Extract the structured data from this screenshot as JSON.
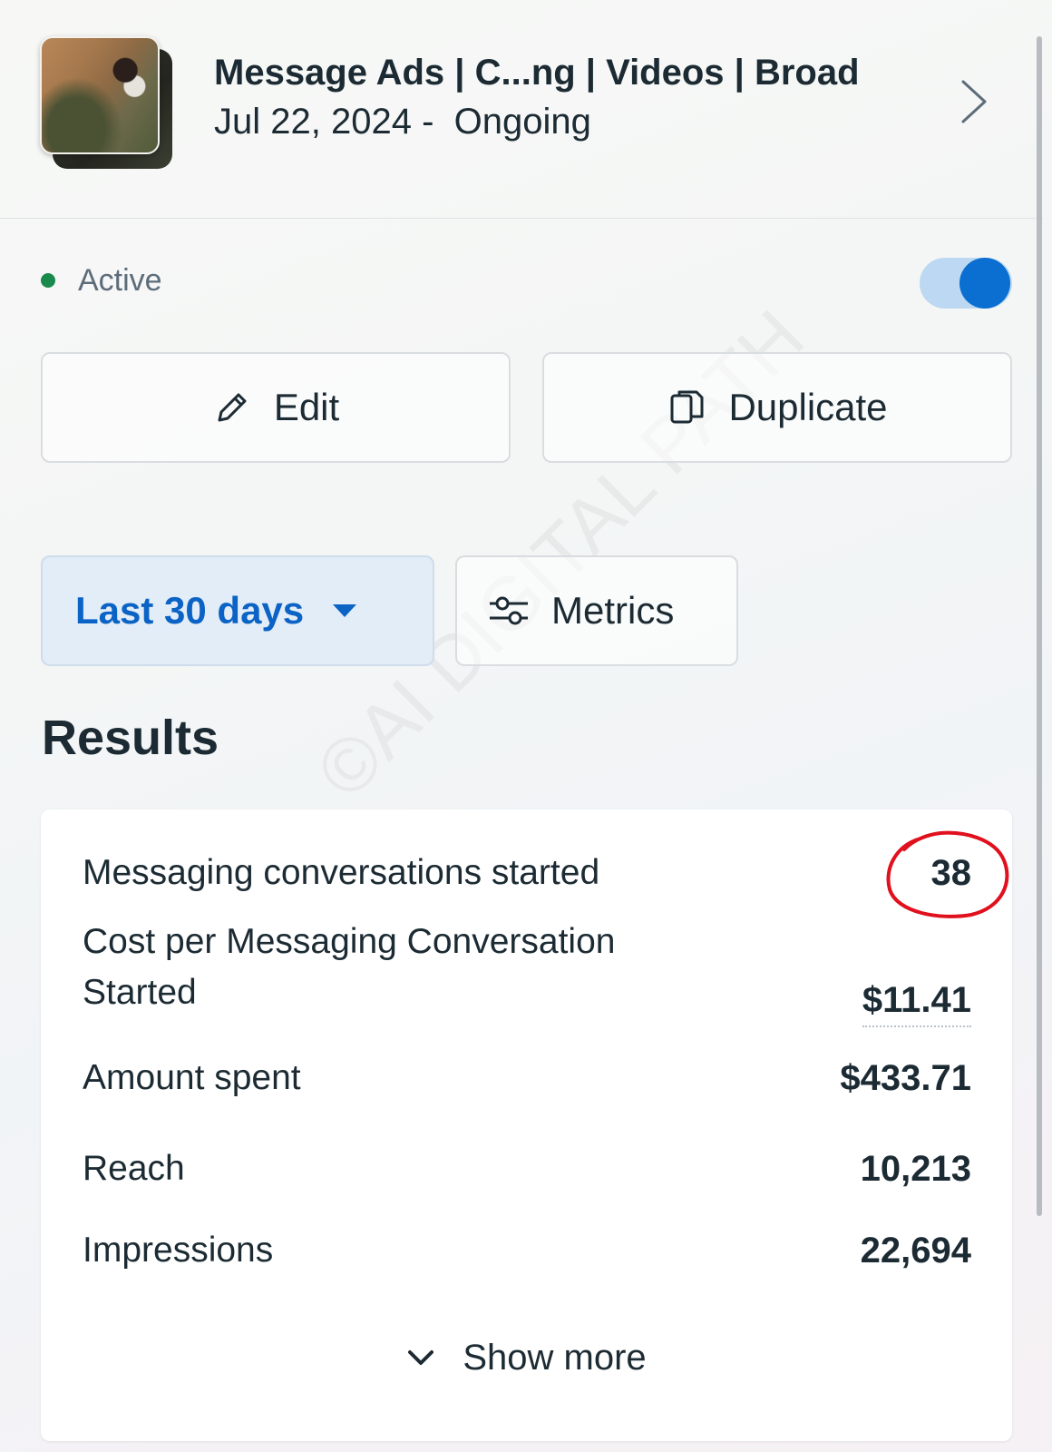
{
  "campaign": {
    "title": "Message Ads | C...ng | Videos | Broad",
    "date_range": "Jul 22, 2024 -  Ongoing"
  },
  "status": {
    "label": "Active",
    "toggle_on": true,
    "dot_color": "#1a8a4c"
  },
  "actions": {
    "edit_label": "Edit",
    "duplicate_label": "Duplicate"
  },
  "filters": {
    "date_range_label": "Last 30 days",
    "metrics_label": "Metrics"
  },
  "results": {
    "title": "Results",
    "rows": [
      {
        "label": "Messaging conversations started",
        "value": "38"
      },
      {
        "label": "Cost per Messaging Conversation Started",
        "value": "$11.41"
      },
      {
        "label": "Amount spent",
        "value": "$433.71"
      },
      {
        "label": "Reach",
        "value": "10,213"
      },
      {
        "label": "Impressions",
        "value": "22,694"
      }
    ],
    "show_more_label": "Show more"
  },
  "watermark": "©AI DIGITAL PATH",
  "colors": {
    "accent": "#0a6fd1",
    "accent_bg": "#e3edf7",
    "text": "#1c2b33",
    "highlight_ring": "#e0101c"
  },
  "icons": {
    "edit": "pencil-icon",
    "duplicate": "copy-icon",
    "metrics": "sliders-icon",
    "range_dropdown": "caret-down-icon",
    "open": "chevron-right-icon",
    "show_more": "chevron-down-icon"
  }
}
